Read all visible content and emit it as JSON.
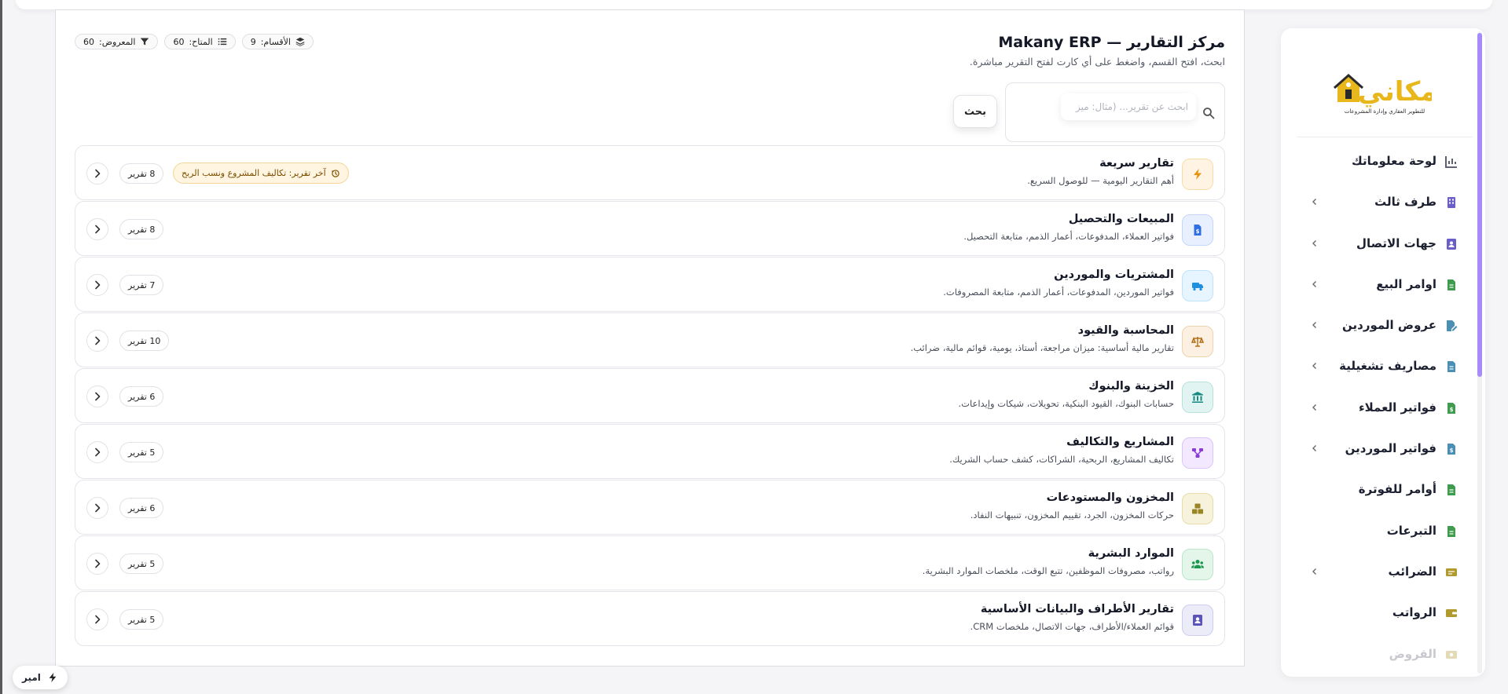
{
  "page": {
    "title": "مركز التقارير — Makany ERP",
    "subtitle": "ابحث، افتح القسم، واضغط على أي كارت لفتح التقرير مباشرة."
  },
  "stats": [
    {
      "label": "المعروض:",
      "value": "60",
      "icon": "filter-icon"
    },
    {
      "label": "المتاح:",
      "value": "60",
      "icon": "list-icon"
    },
    {
      "label": "الأقسام:",
      "value": "9",
      "icon": "layers-icon"
    }
  ],
  "search": {
    "placeholder": "ابحث عن تقرير... (مثال: ميز",
    "button_label": "بحث"
  },
  "sections": [
    {
      "title": "تقارير سريعة",
      "desc": "أهم التقارير اليومية — للوصول السريع.",
      "count": "8 تقرير",
      "icon": "bolt-icon",
      "color": "#e8930c",
      "bg": "#fff4e3",
      "border": "#f7dca8",
      "last": "آخر تقرير: تكاليف المشروع ونسب الربح"
    },
    {
      "title": "المبيعات والتحصيل",
      "desc": "فواتير العملاء، المدفوعات، أعمار الذمم، متابعة التحصيل.",
      "count": "8 تقرير",
      "icon": "invoice-dollar-icon",
      "color": "#2f6fe0",
      "bg": "#e8f0ff",
      "border": "#c3d6fb"
    },
    {
      "title": "المشتريات والموردين",
      "desc": "فواتير الموردين، المدفوعات، أعمار الذمم، متابعة المصروفات.",
      "count": "7 تقرير",
      "icon": "truck-icon",
      "color": "#1f8fe0",
      "bg": "#e6f5ff",
      "border": "#bfe3fb"
    },
    {
      "title": "المحاسبة والقيود",
      "desc": "تقارير مالية أساسية: ميزان مراجعة، أستاذ، يومية، قوائم مالية، ضرائب.",
      "count": "10 تقرير",
      "icon": "scale-icon",
      "color": "#b06a10",
      "bg": "#fbf0e1",
      "border": "#efd3ad"
    },
    {
      "title": "الخزينة والبنوك",
      "desc": "حسابات البنوك، القيود البنكية، تحويلات، شيكات وإيداعات.",
      "count": "6 تقرير",
      "icon": "bank-icon",
      "color": "#158a80",
      "bg": "#e2f4f1",
      "border": "#b8e1da"
    },
    {
      "title": "المشاريع والتكاليف",
      "desc": "تكاليف المشاريع، الربحية، الشراكات، كشف حساب الشريك.",
      "count": "5 تقرير",
      "icon": "project-diagram-icon",
      "color": "#8a3ad8",
      "bg": "#f2e8ff",
      "border": "#dcc6f7"
    },
    {
      "title": "المخزون والمستودعات",
      "desc": "حركات المخزون، الجرد، تقييم المخزون، تنبيهات النفاد.",
      "count": "6 تقرير",
      "icon": "boxes-icon",
      "color": "#9a8424",
      "bg": "#f7f2dc",
      "border": "#e8dcaa"
    },
    {
      "title": "الموارد البشرية",
      "desc": "رواتب، مصروفات الموظفين، تتبع الوقت، ملخصات الموارد البشرية.",
      "count": "5 تقرير",
      "icon": "users-icon",
      "color": "#1d9650",
      "bg": "#e4f6ea",
      "border": "#bce6cb"
    },
    {
      "title": "تقارير الأطراف والبيانات الأساسية",
      "desc": "قوائم العملاء/الأطراف، جهات الاتصال، ملخصات CRM.",
      "count": "5 تقرير",
      "icon": "contact-card-icon",
      "color": "#5b55b8",
      "bg": "#ecebf8",
      "border": "#cfcdee"
    }
  ],
  "sidebar": {
    "logo_text": "مكاني",
    "logo_tagline": "للتطوير العقاري وإدارة المشروعات",
    "items": [
      {
        "label": "لوحة معلوماتك",
        "icon": "dashboard-icon",
        "color": "#4a4f60",
        "chevron": false
      },
      {
        "label": "طرف ثالث",
        "icon": "building-icon",
        "color": "#6b5fc7",
        "chevron": true
      },
      {
        "label": "جهات الاتصال",
        "icon": "address-book-icon",
        "color": "#6b5fc7",
        "chevron": true
      },
      {
        "label": "اوامر البيع",
        "icon": "file-icon",
        "color": "#3f9b4e",
        "chevron": true
      },
      {
        "label": "عروض الموردين",
        "icon": "file-signature-icon",
        "color": "#4b8fb5",
        "chevron": true
      },
      {
        "label": "مصاريف تشغيلية",
        "icon": "file-icon",
        "color": "#4b8fb5",
        "chevron": true
      },
      {
        "label": "فواتير العملاء",
        "icon": "file-invoice-icon",
        "color": "#3f9b4e",
        "chevron": true
      },
      {
        "label": "فواتير الموردين",
        "icon": "file-invoice-icon",
        "color": "#4b8fb5",
        "chevron": true
      },
      {
        "label": "أوامر للفوترة",
        "icon": "file-icon",
        "color": "#3f9b4e",
        "chevron": false
      },
      {
        "label": "التبرعات",
        "icon": "file-icon",
        "color": "#3f9b4e",
        "chevron": false
      },
      {
        "label": "الضرائب",
        "icon": "receipt-icon",
        "color": "#b09a2e",
        "chevron": true
      },
      {
        "label": "الرواتب",
        "icon": "wallet-icon",
        "color": "#b09a2e",
        "chevron": false
      },
      {
        "label": "القروض",
        "icon": "money-icon",
        "color": "#b09a2e",
        "chevron": false,
        "faded": true
      }
    ]
  },
  "user": {
    "name": "امير"
  }
}
